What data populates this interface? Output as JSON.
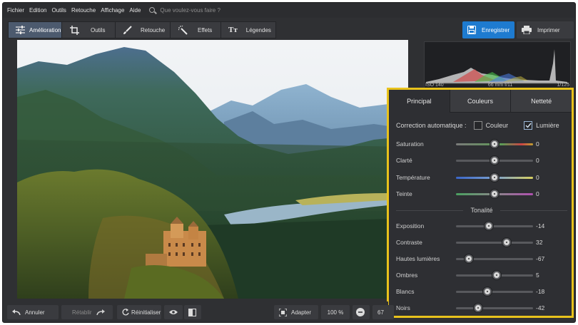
{
  "menu": {
    "items": [
      "Fichier",
      "Edition",
      "Outils",
      "Retouche",
      "Affichage",
      "Aide"
    ],
    "search_placeholder": "Que voulez-vous faire ?"
  },
  "toolbar": {
    "tabs": [
      {
        "label": "Amélioration",
        "icon": "sliders-icon",
        "active": true
      },
      {
        "label": "Outils",
        "icon": "crop-icon"
      },
      {
        "label": "Retouche",
        "icon": "brush-icon"
      },
      {
        "label": "Effets",
        "icon": "magic-wand-icon"
      },
      {
        "label": "Légendes",
        "icon": "text-icon"
      }
    ],
    "save_label": "Enregistrer",
    "print_label": "Imprimer"
  },
  "histogram": {
    "iso": "ISO 140",
    "focal": "66 mm f/11",
    "shutter": "1/125"
  },
  "panel": {
    "tabs": [
      "Principal",
      "Couleurs",
      "Netteté"
    ],
    "active_tab": "Principal",
    "auto_label": "Correction automatique :",
    "auto_color": {
      "label": "Couleur",
      "checked": false
    },
    "auto_light": {
      "label": "Lumière",
      "checked": true
    },
    "color_sliders": [
      {
        "label": "Saturation",
        "value": 0
      },
      {
        "label": "Clarté",
        "value": 0
      },
      {
        "label": "Température",
        "value": 0
      },
      {
        "label": "Teinte",
        "value": 0
      }
    ],
    "section_title": "Tonalité",
    "tone_sliders": [
      {
        "label": "Exposition",
        "value": -14
      },
      {
        "label": "Contraste",
        "value": 32
      },
      {
        "label": "Hautes lumières",
        "value": -67
      },
      {
        "label": "Ombres",
        "value": 5
      },
      {
        "label": "Blancs",
        "value": -18
      },
      {
        "label": "Noirs",
        "value": -42
      }
    ]
  },
  "bottom": {
    "undo_label": "Annuler",
    "redo_label": "Rétablir",
    "reset_label": "Réinitialiser",
    "fit_label": "Adapter",
    "zoom_label": "100 %",
    "zoom_value_partial": "67"
  },
  "colors": {
    "accent": "#1e7bd0",
    "highlight_border": "#e8c21c",
    "background": "#2f3033"
  }
}
